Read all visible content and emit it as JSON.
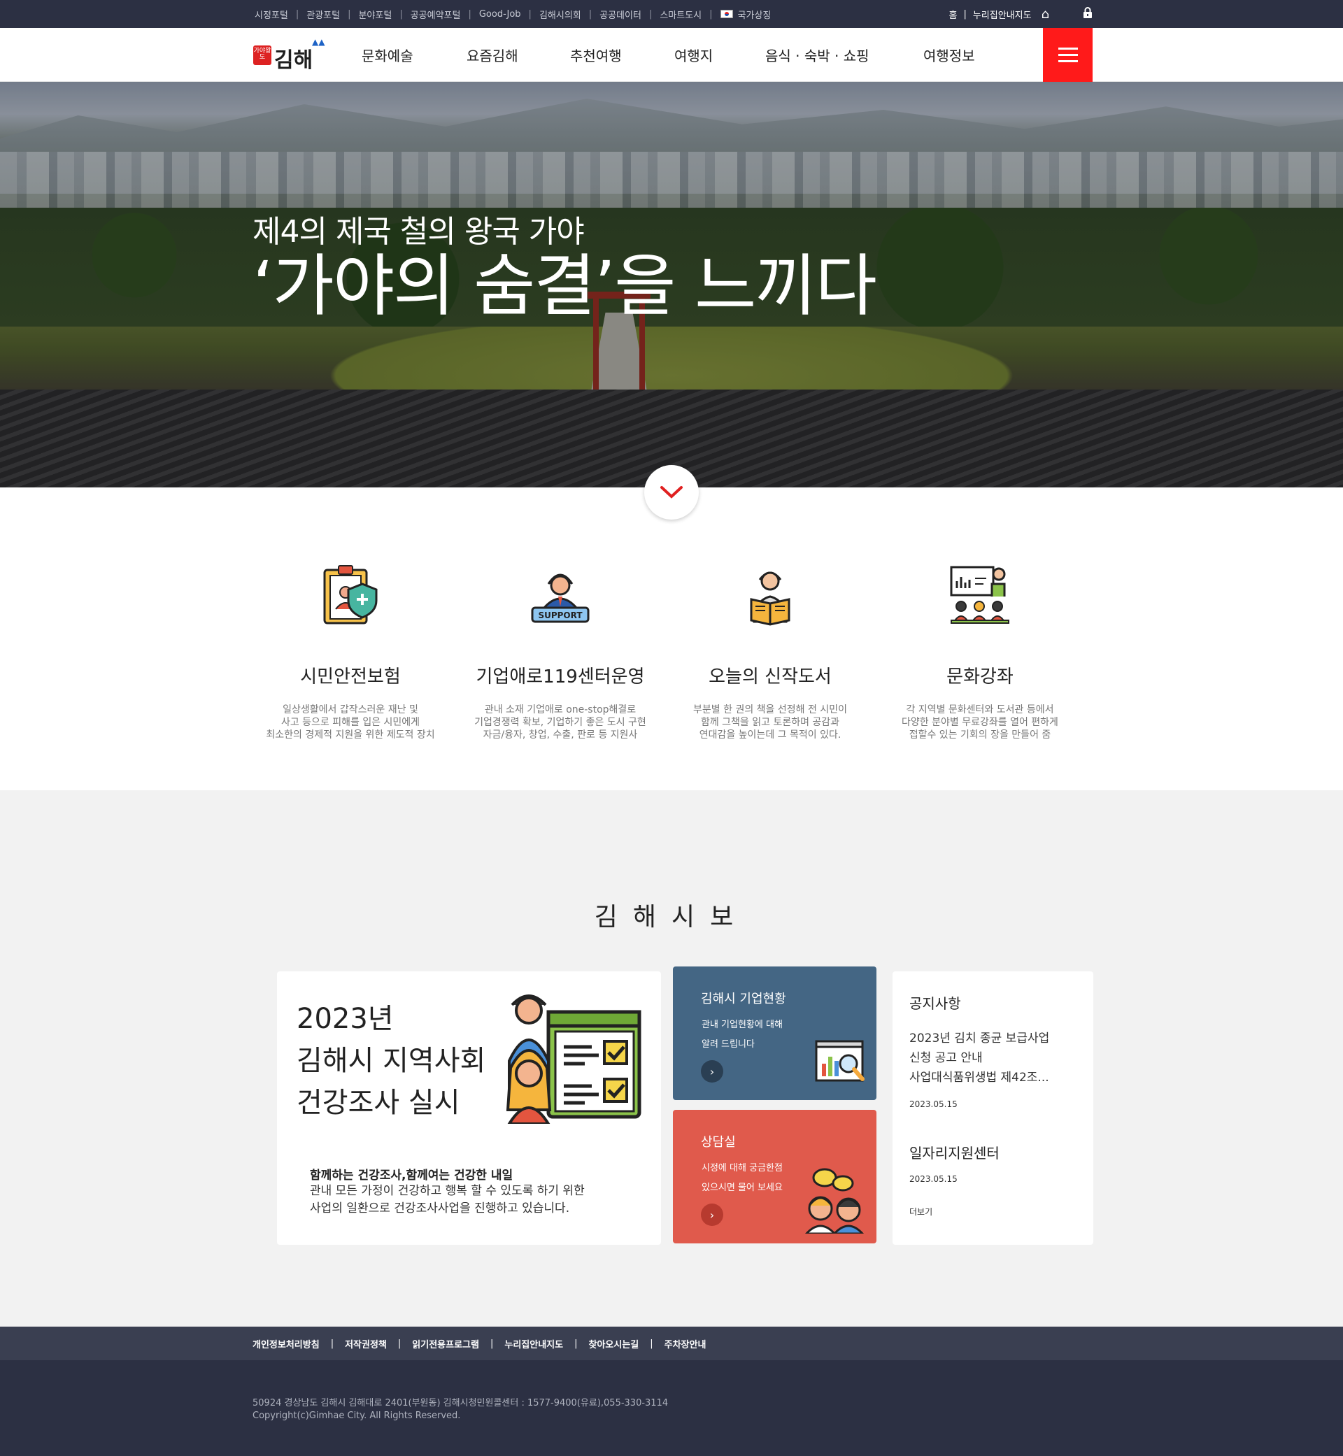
{
  "topbar": {
    "links": [
      "시정포털",
      "관광포털",
      "분야포털",
      "공공예약포털",
      "Good-Job",
      "김해시의회",
      "공공데이터",
      "스마트도시",
      "국가상징"
    ],
    "right": {
      "home": "홈",
      "map": "누리집안내지도"
    }
  },
  "nav": {
    "logo_badge": "가야왕도",
    "logo_text": "김해",
    "menu": [
      "문화예술",
      "요즘김해",
      "추천여행",
      "여행지",
      "음식 · 숙박 · 쇼핑",
      "여행정보"
    ]
  },
  "hero": {
    "subtitle": "제4의 제국 철의 왕국 가야",
    "title": "‘가야의 숨결’을 느끼다"
  },
  "services": [
    {
      "icon": "safety-insurance-icon",
      "title": "시민안전보험",
      "desc": "일상생활에서 갑작스러운 재난 및\n사고 등으로 피해를 입은 시민에게\n최소한의 경제적 지원을 위한 제도적 장치"
    },
    {
      "icon": "support-agent-icon",
      "title": "기업애로119센터운영",
      "desc": "관내 소재 기업애로 one-stop해결로\n기업경쟁력 확보, 기업하기 좋은 도시 구현\n자금/융자, 창업, 수출, 판로 등 지원사"
    },
    {
      "icon": "reading-book-icon",
      "title": "오늘의 신작도서",
      "desc": "부분별 한 권의 책을 선정해 전 시민이\n함께 그책을 읽고 토론하며 공감과\n연대감을 높이는데 그 목적이 있다."
    },
    {
      "icon": "lecture-icon",
      "title": "문화강좌",
      "desc": "각 지역별 문화센터와 도서관 등에서\n다양한 분야별 무료강좌를 열어 편하게\n접할수 있는 기회의 장을 만들어 줌"
    }
  ],
  "section_title": "김해시보",
  "main_card": {
    "headline": "2023년\n김해시 지역사회\n건강조사 실시",
    "sub_bold": "함께하는 건강조사,함께여는 건강한 내일",
    "sub_text": "관내 모든 가정이 건강하고 행복 할 수 있도록 하기 위한\n사업의 일환으로 건강조사사업을 진행하고 있습니다."
  },
  "blue_card": {
    "title": "김해시 기업현황",
    "desc": "관내 기업현황에 대해\n알려 드립니다",
    "color": "#446684"
  },
  "red_card": {
    "title": "상담실",
    "desc": "시정에 대해 궁금한점\n있으시면 물어 보세요",
    "color": "#e05a4c"
  },
  "notice_card": {
    "title": "공지사항",
    "item": "2023년 김치 종균 보급사업\n신청 공고 안내\n사업대식품위생법 제42조...",
    "date1": "2023.05.15",
    "title2": "일자리지원센터",
    "date2": "2023.05.15",
    "more": "더보기"
  },
  "footer": {
    "links": [
      "개인정보처리방침",
      "저작권정책",
      "읽기전용프로그램",
      "누리집안내지도",
      "찾아오시는길",
      "주차장안내"
    ],
    "address": "50924 경상남도 김해시 김해대로 2401(부원동) 김해시청민원콜센터 : 1577-9400(유료),055-330-3114\nCopyright(c)Gimhae City. All Rights Reserved."
  },
  "colors": {
    "accent_red": "#ff1a1a",
    "topbar": "#2c3043",
    "footer": "#2c3043"
  }
}
